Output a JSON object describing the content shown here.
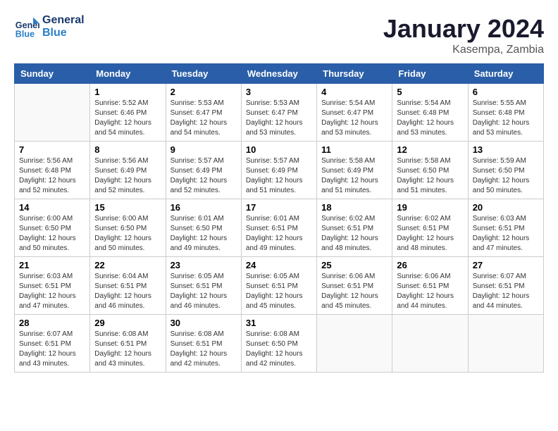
{
  "header": {
    "logo_line1": "General",
    "logo_line2": "Blue",
    "month": "January 2024",
    "location": "Kasempa, Zambia"
  },
  "weekdays": [
    "Sunday",
    "Monday",
    "Tuesday",
    "Wednesday",
    "Thursday",
    "Friday",
    "Saturday"
  ],
  "weeks": [
    [
      {
        "day": "",
        "empty": true
      },
      {
        "day": "1",
        "sunrise": "Sunrise: 5:52 AM",
        "sunset": "Sunset: 6:46 PM",
        "daylight": "Daylight: 12 hours",
        "daylight2": "and 54 minutes."
      },
      {
        "day": "2",
        "sunrise": "Sunrise: 5:53 AM",
        "sunset": "Sunset: 6:47 PM",
        "daylight": "Daylight: 12 hours",
        "daylight2": "and 54 minutes."
      },
      {
        "day": "3",
        "sunrise": "Sunrise: 5:53 AM",
        "sunset": "Sunset: 6:47 PM",
        "daylight": "Daylight: 12 hours",
        "daylight2": "and 53 minutes."
      },
      {
        "day": "4",
        "sunrise": "Sunrise: 5:54 AM",
        "sunset": "Sunset: 6:47 PM",
        "daylight": "Daylight: 12 hours",
        "daylight2": "and 53 minutes."
      },
      {
        "day": "5",
        "sunrise": "Sunrise: 5:54 AM",
        "sunset": "Sunset: 6:48 PM",
        "daylight": "Daylight: 12 hours",
        "daylight2": "and 53 minutes."
      },
      {
        "day": "6",
        "sunrise": "Sunrise: 5:55 AM",
        "sunset": "Sunset: 6:48 PM",
        "daylight": "Daylight: 12 hours",
        "daylight2": "and 53 minutes."
      }
    ],
    [
      {
        "day": "7",
        "sunrise": "Sunrise: 5:56 AM",
        "sunset": "Sunset: 6:48 PM",
        "daylight": "Daylight: 12 hours",
        "daylight2": "and 52 minutes."
      },
      {
        "day": "8",
        "sunrise": "Sunrise: 5:56 AM",
        "sunset": "Sunset: 6:49 PM",
        "daylight": "Daylight: 12 hours",
        "daylight2": "and 52 minutes."
      },
      {
        "day": "9",
        "sunrise": "Sunrise: 5:57 AM",
        "sunset": "Sunset: 6:49 PM",
        "daylight": "Daylight: 12 hours",
        "daylight2": "and 52 minutes."
      },
      {
        "day": "10",
        "sunrise": "Sunrise: 5:57 AM",
        "sunset": "Sunset: 6:49 PM",
        "daylight": "Daylight: 12 hours",
        "daylight2": "and 51 minutes."
      },
      {
        "day": "11",
        "sunrise": "Sunrise: 5:58 AM",
        "sunset": "Sunset: 6:49 PM",
        "daylight": "Daylight: 12 hours",
        "daylight2": "and 51 minutes."
      },
      {
        "day": "12",
        "sunrise": "Sunrise: 5:58 AM",
        "sunset": "Sunset: 6:50 PM",
        "daylight": "Daylight: 12 hours",
        "daylight2": "and 51 minutes."
      },
      {
        "day": "13",
        "sunrise": "Sunrise: 5:59 AM",
        "sunset": "Sunset: 6:50 PM",
        "daylight": "Daylight: 12 hours",
        "daylight2": "and 50 minutes."
      }
    ],
    [
      {
        "day": "14",
        "sunrise": "Sunrise: 6:00 AM",
        "sunset": "Sunset: 6:50 PM",
        "daylight": "Daylight: 12 hours",
        "daylight2": "and 50 minutes."
      },
      {
        "day": "15",
        "sunrise": "Sunrise: 6:00 AM",
        "sunset": "Sunset: 6:50 PM",
        "daylight": "Daylight: 12 hours",
        "daylight2": "and 50 minutes."
      },
      {
        "day": "16",
        "sunrise": "Sunrise: 6:01 AM",
        "sunset": "Sunset: 6:50 PM",
        "daylight": "Daylight: 12 hours",
        "daylight2": "and 49 minutes."
      },
      {
        "day": "17",
        "sunrise": "Sunrise: 6:01 AM",
        "sunset": "Sunset: 6:51 PM",
        "daylight": "Daylight: 12 hours",
        "daylight2": "and 49 minutes."
      },
      {
        "day": "18",
        "sunrise": "Sunrise: 6:02 AM",
        "sunset": "Sunset: 6:51 PM",
        "daylight": "Daylight: 12 hours",
        "daylight2": "and 48 minutes."
      },
      {
        "day": "19",
        "sunrise": "Sunrise: 6:02 AM",
        "sunset": "Sunset: 6:51 PM",
        "daylight": "Daylight: 12 hours",
        "daylight2": "and 48 minutes."
      },
      {
        "day": "20",
        "sunrise": "Sunrise: 6:03 AM",
        "sunset": "Sunset: 6:51 PM",
        "daylight": "Daylight: 12 hours",
        "daylight2": "and 47 minutes."
      }
    ],
    [
      {
        "day": "21",
        "sunrise": "Sunrise: 6:03 AM",
        "sunset": "Sunset: 6:51 PM",
        "daylight": "Daylight: 12 hours",
        "daylight2": "and 47 minutes."
      },
      {
        "day": "22",
        "sunrise": "Sunrise: 6:04 AM",
        "sunset": "Sunset: 6:51 PM",
        "daylight": "Daylight: 12 hours",
        "daylight2": "and 46 minutes."
      },
      {
        "day": "23",
        "sunrise": "Sunrise: 6:05 AM",
        "sunset": "Sunset: 6:51 PM",
        "daylight": "Daylight: 12 hours",
        "daylight2": "and 46 minutes."
      },
      {
        "day": "24",
        "sunrise": "Sunrise: 6:05 AM",
        "sunset": "Sunset: 6:51 PM",
        "daylight": "Daylight: 12 hours",
        "daylight2": "and 45 minutes."
      },
      {
        "day": "25",
        "sunrise": "Sunrise: 6:06 AM",
        "sunset": "Sunset: 6:51 PM",
        "daylight": "Daylight: 12 hours",
        "daylight2": "and 45 minutes."
      },
      {
        "day": "26",
        "sunrise": "Sunrise: 6:06 AM",
        "sunset": "Sunset: 6:51 PM",
        "daylight": "Daylight: 12 hours",
        "daylight2": "and 44 minutes."
      },
      {
        "day": "27",
        "sunrise": "Sunrise: 6:07 AM",
        "sunset": "Sunset: 6:51 PM",
        "daylight": "Daylight: 12 hours",
        "daylight2": "and 44 minutes."
      }
    ],
    [
      {
        "day": "28",
        "sunrise": "Sunrise: 6:07 AM",
        "sunset": "Sunset: 6:51 PM",
        "daylight": "Daylight: 12 hours",
        "daylight2": "and 43 minutes."
      },
      {
        "day": "29",
        "sunrise": "Sunrise: 6:08 AM",
        "sunset": "Sunset: 6:51 PM",
        "daylight": "Daylight: 12 hours",
        "daylight2": "and 43 minutes."
      },
      {
        "day": "30",
        "sunrise": "Sunrise: 6:08 AM",
        "sunset": "Sunset: 6:51 PM",
        "daylight": "Daylight: 12 hours",
        "daylight2": "and 42 minutes."
      },
      {
        "day": "31",
        "sunrise": "Sunrise: 6:08 AM",
        "sunset": "Sunset: 6:50 PM",
        "daylight": "Daylight: 12 hours",
        "daylight2": "and 42 minutes."
      },
      {
        "day": "",
        "empty": true
      },
      {
        "day": "",
        "empty": true
      },
      {
        "day": "",
        "empty": true
      }
    ]
  ]
}
